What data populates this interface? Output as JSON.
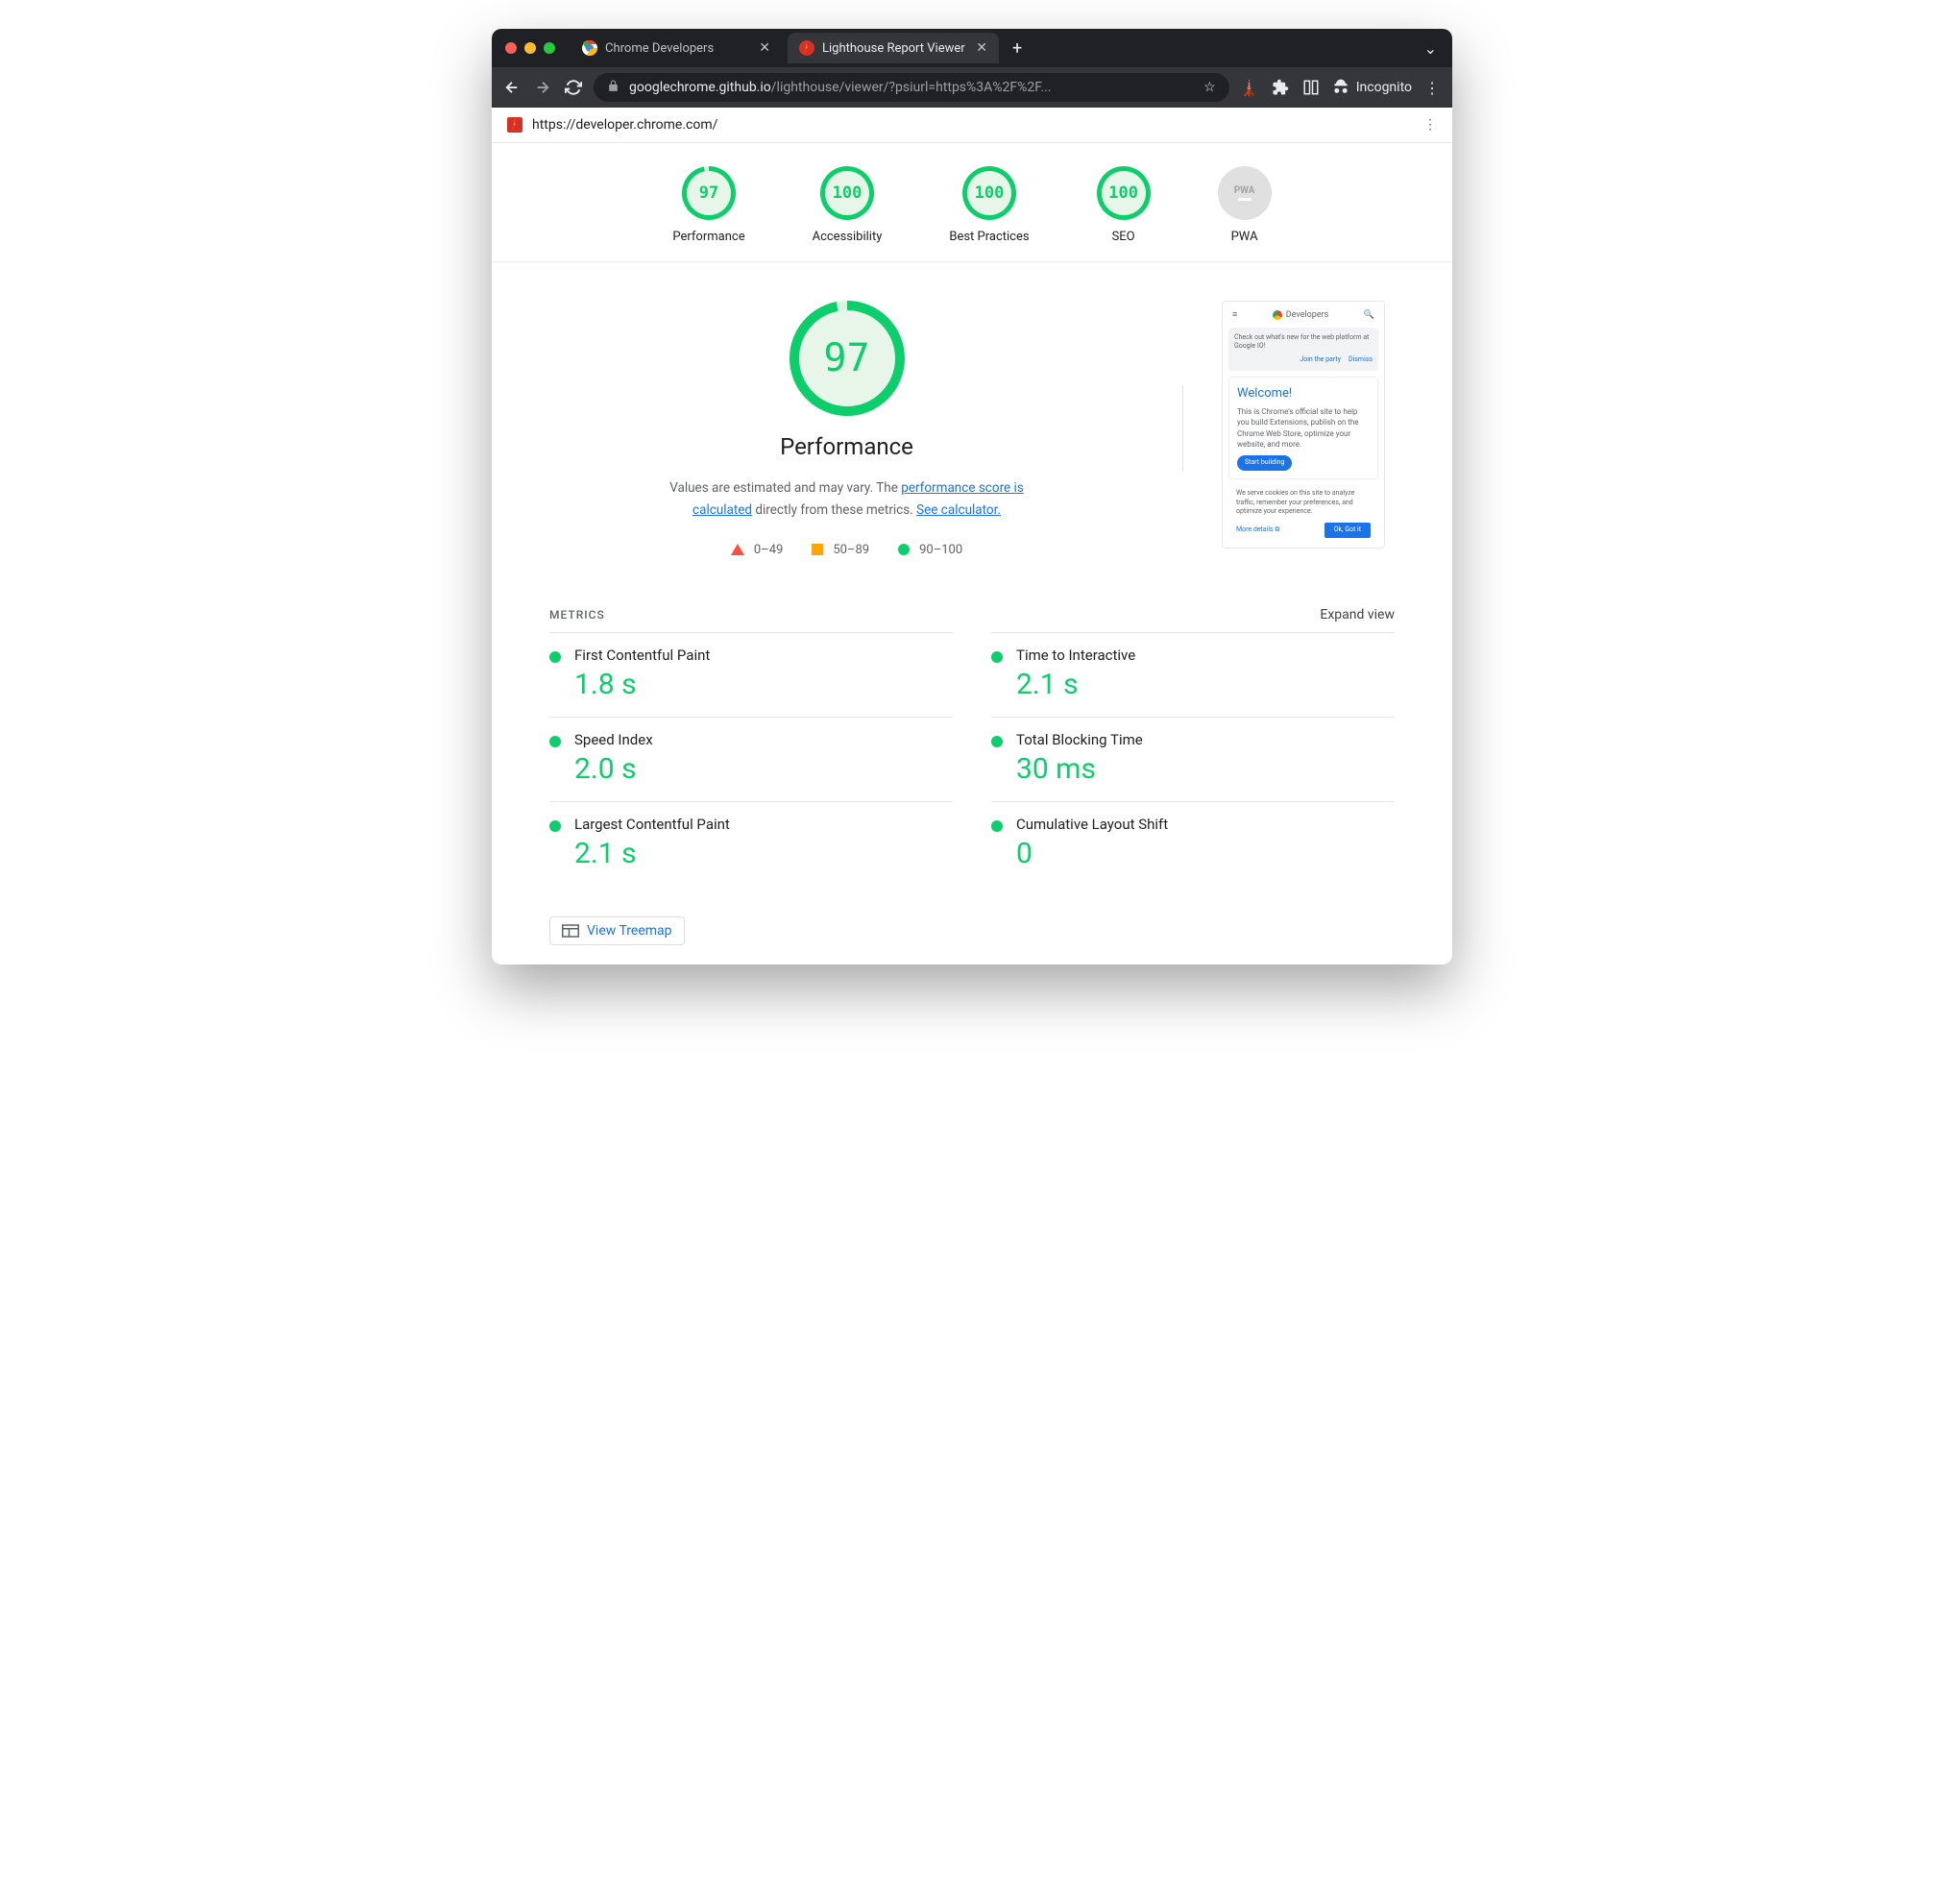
{
  "browser": {
    "tabs": [
      {
        "title": "Chrome Developers",
        "active": false
      },
      {
        "title": "Lighthouse Report Viewer",
        "active": true
      }
    ],
    "url_display_host": "googlechrome.github.io",
    "url_display_path": "/lighthouse/viewer/?psiurl=https%3A%2F%2F...",
    "incognito_label": "Incognito"
  },
  "page": {
    "tested_url": "https://developer.chrome.com/"
  },
  "gauges": [
    {
      "label": "Performance",
      "score": "97",
      "percent": 97
    },
    {
      "label": "Accessibility",
      "score": "100",
      "percent": 100
    },
    {
      "label": "Best Practices",
      "score": "100",
      "percent": 100
    },
    {
      "label": "SEO",
      "score": "100",
      "percent": 100
    },
    {
      "label": "PWA",
      "score": "PWA",
      "type": "pwa"
    }
  ],
  "performance": {
    "big_score": "97",
    "big_percent": 97,
    "title": "Performance",
    "desc_prefix": "Values are estimated and may vary. The ",
    "desc_link1": "performance score is calculated",
    "desc_mid": " directly from these metrics. ",
    "desc_link2": "See calculator.",
    "legend": {
      "fail": "0–49",
      "avg": "50–89",
      "pass": "90–100"
    }
  },
  "screenshot_preview": {
    "header": "Developers",
    "banner_text": "Check out what's new for the web platform at Google IO!",
    "banner_link1": "Join the party",
    "banner_link2": "Dismiss",
    "card_title": "Welcome!",
    "card_text": "This is Chrome's official site to help you build Extensions, publish on the Chrome Web Store, optimize your website, and more.",
    "card_button": "Start building",
    "cookie_text": "We serve cookies on this site to analyze traffic, remember your preferences, and optimize your experience.",
    "more_details": "More details",
    "ok_btn": "Ok, Got it"
  },
  "metrics_section": {
    "label": "METRICS",
    "expand": "Expand view",
    "items": [
      {
        "name": "First Contentful Paint",
        "value": "1.8 s"
      },
      {
        "name": "Time to Interactive",
        "value": "2.1 s"
      },
      {
        "name": "Speed Index",
        "value": "2.0 s"
      },
      {
        "name": "Total Blocking Time",
        "value": "30 ms"
      },
      {
        "name": "Largest Contentful Paint",
        "value": "2.1 s"
      },
      {
        "name": "Cumulative Layout Shift",
        "value": "0"
      }
    ]
  },
  "treemap": {
    "label": "View Treemap"
  },
  "colors": {
    "pass": "#0cce6b",
    "avg": "#ffa400",
    "fail": "#ff4e42",
    "link": "#1a73e8"
  }
}
